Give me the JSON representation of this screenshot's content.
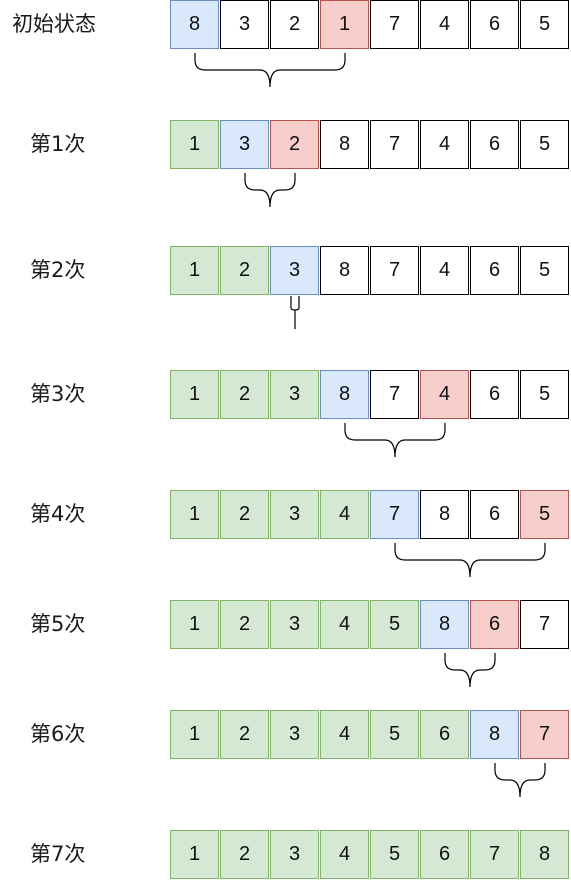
{
  "colors": {
    "sorted_fill": "#d5e8d4",
    "sorted_border": "#82b366",
    "current_fill": "#dae8fc",
    "current_border": "#6c8ebf",
    "min_fill": "#f8cecc",
    "min_border": "#b85450",
    "plain_fill": "#ffffff",
    "plain_border": "#000000"
  },
  "rows": [
    {
      "label": "初始状态",
      "values": [
        "8",
        "3",
        "2",
        "1",
        "7",
        "4",
        "6",
        "5"
      ],
      "states": [
        "current",
        "plain",
        "plain",
        "min",
        "plain",
        "plain",
        "plain",
        "plain"
      ]
    },
    {
      "label": "第1次",
      "values": [
        "1",
        "3",
        "2",
        "8",
        "7",
        "4",
        "6",
        "5"
      ],
      "states": [
        "sorted",
        "current",
        "min",
        "plain",
        "plain",
        "plain",
        "plain",
        "plain"
      ]
    },
    {
      "label": "第2次",
      "values": [
        "1",
        "2",
        "3",
        "8",
        "7",
        "4",
        "6",
        "5"
      ],
      "states": [
        "sorted",
        "sorted",
        "current",
        "plain",
        "plain",
        "plain",
        "plain",
        "plain"
      ]
    },
    {
      "label": "第3次",
      "values": [
        "1",
        "2",
        "3",
        "8",
        "7",
        "4",
        "6",
        "5"
      ],
      "states": [
        "sorted",
        "sorted",
        "sorted",
        "current",
        "plain",
        "min",
        "plain",
        "plain"
      ]
    },
    {
      "label": "第4次",
      "values": [
        "1",
        "2",
        "3",
        "4",
        "7",
        "8",
        "6",
        "5"
      ],
      "states": [
        "sorted",
        "sorted",
        "sorted",
        "sorted",
        "current",
        "plain",
        "plain",
        "min"
      ]
    },
    {
      "label": "第5次",
      "values": [
        "1",
        "2",
        "3",
        "4",
        "5",
        "8",
        "6",
        "7"
      ],
      "states": [
        "sorted",
        "sorted",
        "sorted",
        "sorted",
        "sorted",
        "current",
        "min",
        "plain"
      ]
    },
    {
      "label": "第6次",
      "values": [
        "1",
        "2",
        "3",
        "4",
        "5",
        "6",
        "8",
        "7"
      ],
      "states": [
        "sorted",
        "sorted",
        "sorted",
        "sorted",
        "sorted",
        "sorted",
        "current",
        "min"
      ]
    },
    {
      "label": "第7次",
      "values": [
        "1",
        "2",
        "3",
        "4",
        "5",
        "6",
        "7",
        "8"
      ],
      "states": [
        "sorted",
        "sorted",
        "sorted",
        "sorted",
        "sorted",
        "sorted",
        "sorted",
        "sorted"
      ]
    }
  ],
  "swap_pairs": [
    {
      "from_index": 0,
      "to_index": 3
    },
    {
      "from_index": 1,
      "to_index": 2
    },
    {
      "from_index": 2,
      "to_index": 2
    },
    {
      "from_index": 3,
      "to_index": 5
    },
    {
      "from_index": 4,
      "to_index": 7
    },
    {
      "from_index": 5,
      "to_index": 6
    },
    {
      "from_index": 6,
      "to_index": 7
    }
  ]
}
